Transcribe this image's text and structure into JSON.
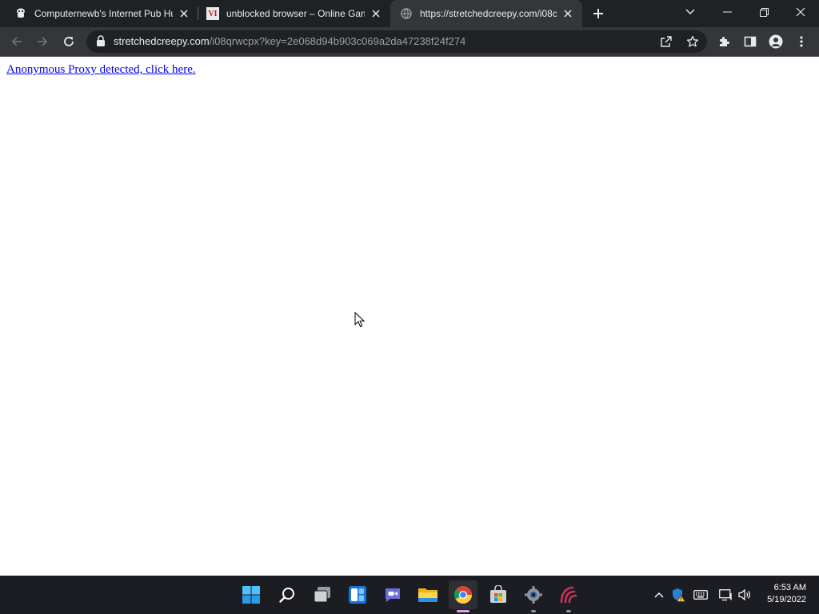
{
  "browser": {
    "tabs": [
      {
        "title": "Computernewb's Internet Pub Hu",
        "favicon": "computernewb-favicon",
        "active": false
      },
      {
        "title": "unblocked browser – Online Gam",
        "favicon": "vi-favicon",
        "favicon_text": "VI",
        "active": false
      },
      {
        "title": "https://stretchedcreepy.com/i08c",
        "favicon": "globe-icon",
        "active": true
      }
    ],
    "address_bar": {
      "host": "stretchedcreepy.com",
      "path": "/i08qrwcpx?key=2e068d94b903c069a2da47238f24f274"
    }
  },
  "page": {
    "link_text": "Anonymous Proxy detected, click here."
  },
  "taskbar": {
    "apps": [
      "start-icon",
      "search-icon",
      "task-view-icon",
      "widgets-icon",
      "chat-icon",
      "file-explorer-icon",
      "chrome-icon",
      "store-icon",
      "settings-icon",
      "app-icon"
    ],
    "clock": {
      "time": "6:53 AM",
      "date": "5/19/2022"
    }
  },
  "colors": {
    "tabstrip": "#202124",
    "toolbar": "#35363a",
    "link": "#0000ee",
    "taskbar": "#1c1d22"
  }
}
